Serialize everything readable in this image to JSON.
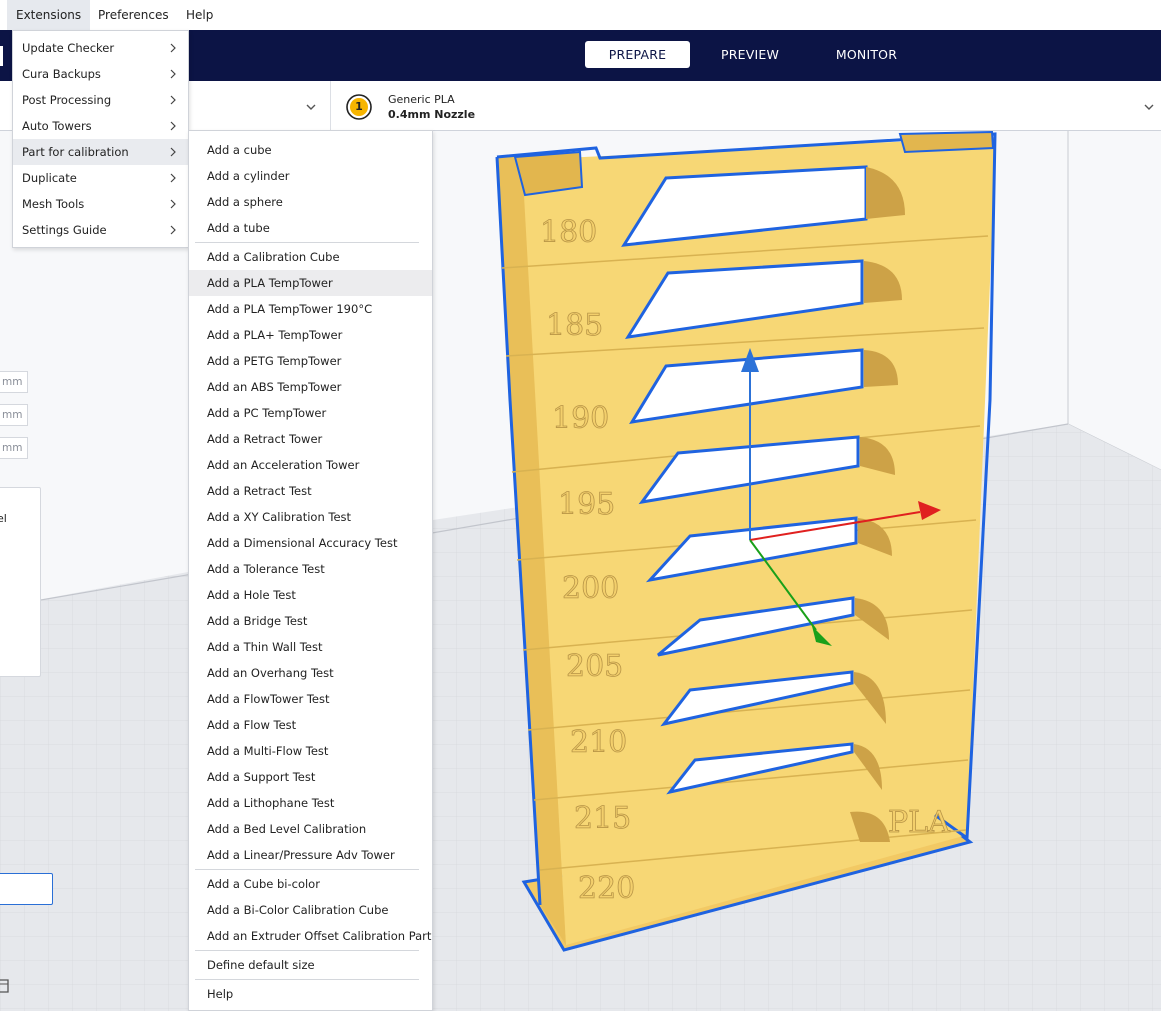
{
  "menubar": {
    "items": [
      {
        "label": "Extensions",
        "mnemonic_underline": "E"
      },
      {
        "label": "Preferences",
        "mnemonic_underline": "r"
      },
      {
        "label": "Help",
        "mnemonic_underline": "H"
      }
    ]
  },
  "header": {
    "tabs": [
      {
        "label": "PREPARE",
        "active": true
      },
      {
        "label": "PREVIEW",
        "active": false
      },
      {
        "label": "MONITOR",
        "active": false
      }
    ],
    "colors": {
      "background": "#0c1445",
      "active_tab_bg": "#ffffff"
    }
  },
  "configbar": {
    "extruder_badge": "1",
    "material": "Generic PLA",
    "nozzle": "0.4mm Nozzle",
    "badge_color": "#f7b500"
  },
  "left_panel": {
    "units": [
      "mm",
      "mm",
      "mm"
    ],
    "fragment_text": "el"
  },
  "extensions_menu": {
    "items": [
      {
        "label": "Update Checker",
        "submenu": true
      },
      {
        "label": "Cura Backups",
        "submenu": true
      },
      {
        "label": "Post Processing",
        "submenu": true
      },
      {
        "label": "Auto Towers",
        "submenu": true
      },
      {
        "label": "Part for calibration",
        "submenu": true,
        "highlighted": true
      },
      {
        "label": "Duplicate",
        "submenu": true
      },
      {
        "label": "Mesh Tools",
        "submenu": true
      },
      {
        "label": "Settings Guide",
        "submenu": true
      }
    ]
  },
  "calibration_menu": {
    "groups": [
      [
        "Add a cube",
        "Add a cylinder",
        "Add a sphere",
        "Add a tube"
      ],
      [
        "Add a Calibration Cube",
        "Add a PLA TempTower",
        "Add a PLA TempTower 190°C",
        "Add a PLA+ TempTower",
        "Add a PETG TempTower",
        "Add an ABS TempTower",
        "Add a PC TempTower",
        "Add a Retract Tower",
        "Add an Acceleration Tower",
        "Add a Retract Test",
        "Add a XY Calibration Test",
        "Add a Dimensional Accuracy Test",
        "Add a Tolerance Test",
        "Add a Hole Test",
        "Add a Bridge Test",
        "Add a Thin Wall Test",
        "Add an Overhang Test",
        "Add a FlowTower Test",
        "Add a Flow Test",
        "Add a Multi-Flow Test",
        "Add a Support Test",
        "Add a Lithophane Test",
        "Add a Bed Level Calibration",
        "Add a Linear/Pressure Adv Tower"
      ],
      [
        "Add a Cube bi-color",
        "Add a Bi-Color Calibration Cube",
        "Add an Extruder Offset Calibration Part"
      ],
      [
        "Define default size"
      ],
      [
        "Help"
      ]
    ],
    "highlighted": "Add a PLA TempTower"
  },
  "model": {
    "tower_labels": [
      "180",
      "185",
      "190",
      "195",
      "200",
      "205",
      "210",
      "215",
      "220"
    ],
    "base_label": "PLA",
    "colors": {
      "body": "#f7d775",
      "outline": "#1f63e0",
      "x_axis": "#e0201f",
      "y_axis": "#1aa01a",
      "z_axis": "#2c72d8"
    }
  }
}
